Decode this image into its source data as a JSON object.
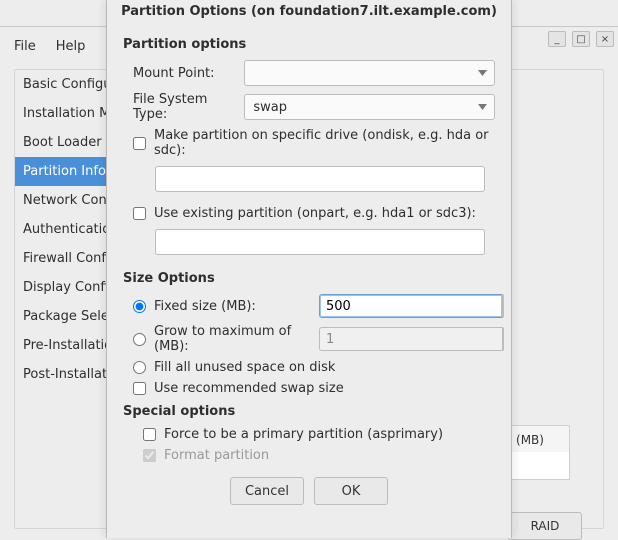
{
  "menubar": {
    "file": "File",
    "help": "Help"
  },
  "window_buttons": {
    "minimize": "_",
    "maximize": "□",
    "close": "×"
  },
  "sidebar": {
    "items": [
      {
        "label": "Basic Configur"
      },
      {
        "label": "Installation Me"
      },
      {
        "label": "Boot Loader O"
      },
      {
        "label": "Partition Inform",
        "selected": true
      },
      {
        "label": "Network Confi"
      },
      {
        "label": "Authentication"
      },
      {
        "label": "Firewall Config"
      },
      {
        "label": "Display Config"
      },
      {
        "label": "Package Selec"
      },
      {
        "label": "Pre-Installation"
      },
      {
        "label": "Post-Installatio"
      }
    ]
  },
  "background_table": {
    "header_mb": "(MB)",
    "raid_button": "RAID"
  },
  "dialog": {
    "title": "Partition Options (on foundation7.ilt.example.com)",
    "section_partition": "Partition options",
    "mount_point_label": "Mount Point:",
    "mount_point_value": "",
    "fs_type_label": "File System Type:",
    "fs_type_value": "swap",
    "make_partition_label": "Make partition on specific drive (ondisk, e.g. hda or sdc):",
    "make_partition_value": "",
    "use_existing_label": "Use existing partition (onpart, e.g. hda1 or sdc3):",
    "use_existing_value": "",
    "section_size": "Size Options",
    "fixed_size_label": "Fixed size (MB):",
    "fixed_size_value": "500",
    "grow_max_label": "Grow to maximum of (MB):",
    "grow_max_value": "1",
    "fill_unused_label": "Fill all unused space on disk",
    "use_recommended_label": "Use recommended swap size",
    "section_special": "Special options",
    "force_primary_label": "Force to be a primary partition (asprimary)",
    "format_partition_label": "Format partition",
    "cancel": "Cancel",
    "ok": "OK"
  }
}
